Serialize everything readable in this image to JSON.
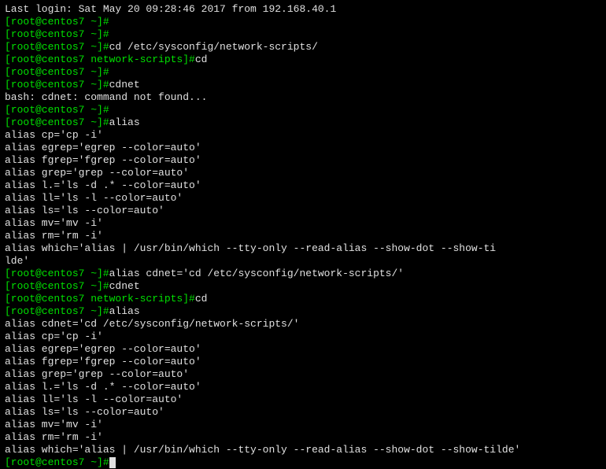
{
  "lines": [
    {
      "type": "output",
      "text": "Last login: Sat May 20 09:28:46 2017 from 192.168.40.1"
    },
    {
      "type": "prompt",
      "prompt": "[root@centos7 ~]#",
      "cmd": ""
    },
    {
      "type": "prompt",
      "prompt": "[root@centos7 ~]#",
      "cmd": ""
    },
    {
      "type": "prompt",
      "prompt": "[root@centos7 ~]#",
      "cmd": "cd /etc/sysconfig/network-scripts/"
    },
    {
      "type": "prompt",
      "prompt": "[root@centos7 network-scripts]#",
      "cmd": "cd"
    },
    {
      "type": "prompt",
      "prompt": "[root@centos7 ~]#",
      "cmd": ""
    },
    {
      "type": "prompt",
      "prompt": "[root@centos7 ~]#",
      "cmd": "cdnet"
    },
    {
      "type": "output",
      "text": "bash: cdnet: command not found..."
    },
    {
      "type": "prompt",
      "prompt": "[root@centos7 ~]#",
      "cmd": ""
    },
    {
      "type": "prompt",
      "prompt": "[root@centos7 ~]#",
      "cmd": "alias"
    },
    {
      "type": "output",
      "text": "alias cp='cp -i'"
    },
    {
      "type": "output",
      "text": "alias egrep='egrep --color=auto'"
    },
    {
      "type": "output",
      "text": "alias fgrep='fgrep --color=auto'"
    },
    {
      "type": "output",
      "text": "alias grep='grep --color=auto'"
    },
    {
      "type": "output",
      "text": "alias l.='ls -d .* --color=auto'"
    },
    {
      "type": "output",
      "text": "alias ll='ls -l --color=auto'"
    },
    {
      "type": "output",
      "text": "alias ls='ls --color=auto'"
    },
    {
      "type": "output",
      "text": "alias mv='mv -i'"
    },
    {
      "type": "output",
      "text": "alias rm='rm -i'"
    },
    {
      "type": "output",
      "text": "alias which='alias | /usr/bin/which --tty-only --read-alias --show-dot --show-ti"
    },
    {
      "type": "output",
      "text": "lde'"
    },
    {
      "type": "prompt",
      "prompt": "[root@centos7 ~]#",
      "cmd": "alias cdnet='cd /etc/sysconfig/network-scripts/'"
    },
    {
      "type": "prompt",
      "prompt": "[root@centos7 ~]#",
      "cmd": "cdnet"
    },
    {
      "type": "prompt",
      "prompt": "[root@centos7 network-scripts]#",
      "cmd": "cd"
    },
    {
      "type": "prompt",
      "prompt": "[root@centos7 ~]#",
      "cmd": "alias"
    },
    {
      "type": "output",
      "text": "alias cdnet='cd /etc/sysconfig/network-scripts/'"
    },
    {
      "type": "output",
      "text": "alias cp='cp -i'"
    },
    {
      "type": "output",
      "text": "alias egrep='egrep --color=auto'"
    },
    {
      "type": "output",
      "text": "alias fgrep='fgrep --color=auto'"
    },
    {
      "type": "output",
      "text": "alias grep='grep --color=auto'"
    },
    {
      "type": "output",
      "text": "alias l.='ls -d .* --color=auto'"
    },
    {
      "type": "output",
      "text": "alias ll='ls -l --color=auto'"
    },
    {
      "type": "output",
      "text": "alias ls='ls --color=auto'"
    },
    {
      "type": "output",
      "text": "alias mv='mv -i'"
    },
    {
      "type": "output",
      "text": "alias rm='rm -i'"
    },
    {
      "type": "output",
      "text": "alias which='alias | /usr/bin/which --tty-only --read-alias --show-dot --show-tilde'"
    },
    {
      "type": "prompt_cursor",
      "prompt": "[root@centos7 ~]#",
      "cmd": ""
    }
  ]
}
